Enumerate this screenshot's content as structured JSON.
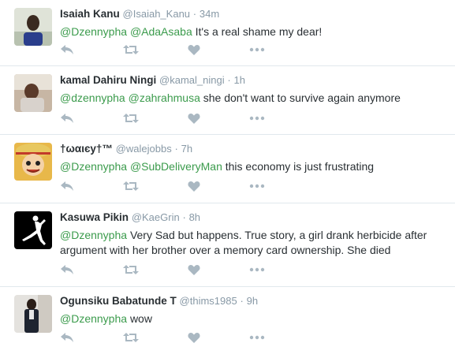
{
  "tweets": [
    {
      "fullname": "Isaiah Kanu",
      "username": "@Isaiah_Kanu",
      "time": "34m",
      "mentions": [
        "@Dzennypha",
        "@AdaAsaba"
      ],
      "text": "It's a real shame my dear!"
    },
    {
      "fullname": "kamal Dahiru Ningi",
      "username": "@kamal_ningi",
      "time": "1h",
      "mentions": [
        "@dzennypha",
        "@zahrahmusa"
      ],
      "text": "she don't want to survive again anymore"
    },
    {
      "fullname": "†ωαιєу†™",
      "username": "@walejobbs",
      "time": "7h",
      "mentions": [
        "@Dzennypha",
        "@SubDeliveryMan"
      ],
      "text": "this economy is just frustrating"
    },
    {
      "fullname": "Kasuwa Pikin",
      "username": "@KaeGrin",
      "time": "8h",
      "mentions": [
        "@Dzennypha"
      ],
      "text": "Very Sad but happens. True story, a girl drank herbicide after argument with her brother over a memory card ownership. She died"
    },
    {
      "fullname": "Ogunsiku Babatunde T",
      "username": "@thims1985",
      "time": "9h",
      "mentions": [
        "@Dzennypha"
      ],
      "text": "wow"
    }
  ],
  "icons": [
    "reply-icon",
    "retweet-icon",
    "like-icon",
    "more-icon"
  ],
  "colors": {
    "mention": "#3b9b4c",
    "muted": "#8899a6",
    "icon": "#aab8c2",
    "divider": "#e1e8ed"
  }
}
